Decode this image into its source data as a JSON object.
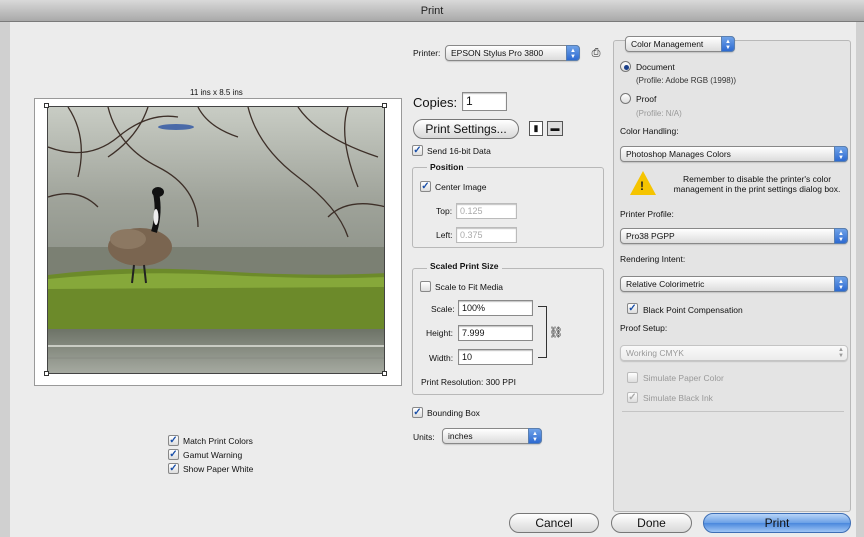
{
  "window": {
    "title": "Print"
  },
  "preview": {
    "size_label": "11 ins x 8.5 ins"
  },
  "printer": {
    "label": "Printer:",
    "value": "EPSON Stylus Pro 3800"
  },
  "copies": {
    "label": "Copies:",
    "value": "1"
  },
  "print_settings_label": "Print Settings...",
  "send16": {
    "label": "Send 16-bit Data",
    "checked": true
  },
  "position": {
    "title": "Position",
    "center_label": "Center Image",
    "top_label": "Top:",
    "top_value": "0.125",
    "left_label": "Left:",
    "left_value": "0.375"
  },
  "scaled": {
    "title": "Scaled Print Size",
    "fit_label": "Scale to Fit Media",
    "scale_label": "Scale:",
    "scale_value": "100%",
    "height_label": "Height:",
    "height_value": "7.999",
    "width_label": "Width:",
    "width_value": "10",
    "resolution": "Print Resolution: 300 PPI"
  },
  "bounding_box_label": "Bounding Box",
  "units": {
    "label": "Units:",
    "value": "inches"
  },
  "left_checks": [
    "Match Print Colors",
    "Gamut Warning",
    "Show Paper White"
  ],
  "color": {
    "section": "Color Management",
    "document_label": "Document",
    "document_profile": "(Profile: Adobe RGB (1998))",
    "proof_label": "Proof",
    "proof_profile": "(Profile: N/A)",
    "handling_label": "Color Handling:",
    "handling_value": "Photoshop Manages Colors",
    "warning": "Remember to disable the printer's color management in the print settings dialog box.",
    "printer_profile_label": "Printer Profile:",
    "printer_profile_value": "Pro38 PGPP",
    "intent_label": "Rendering Intent:",
    "intent_value": "Relative Colorimetric",
    "bpc_label": "Black Point Compensation",
    "proof_setup_label": "Proof Setup:",
    "proof_setup_value": "Working CMYK",
    "sim_paper_label": "Simulate Paper Color",
    "sim_ink_label": "Simulate Black Ink"
  },
  "buttons": {
    "cancel": "Cancel",
    "done": "Done",
    "print": "Print"
  },
  "colors": {
    "accent": "#3d7fdc",
    "warning": "#f5c400"
  }
}
